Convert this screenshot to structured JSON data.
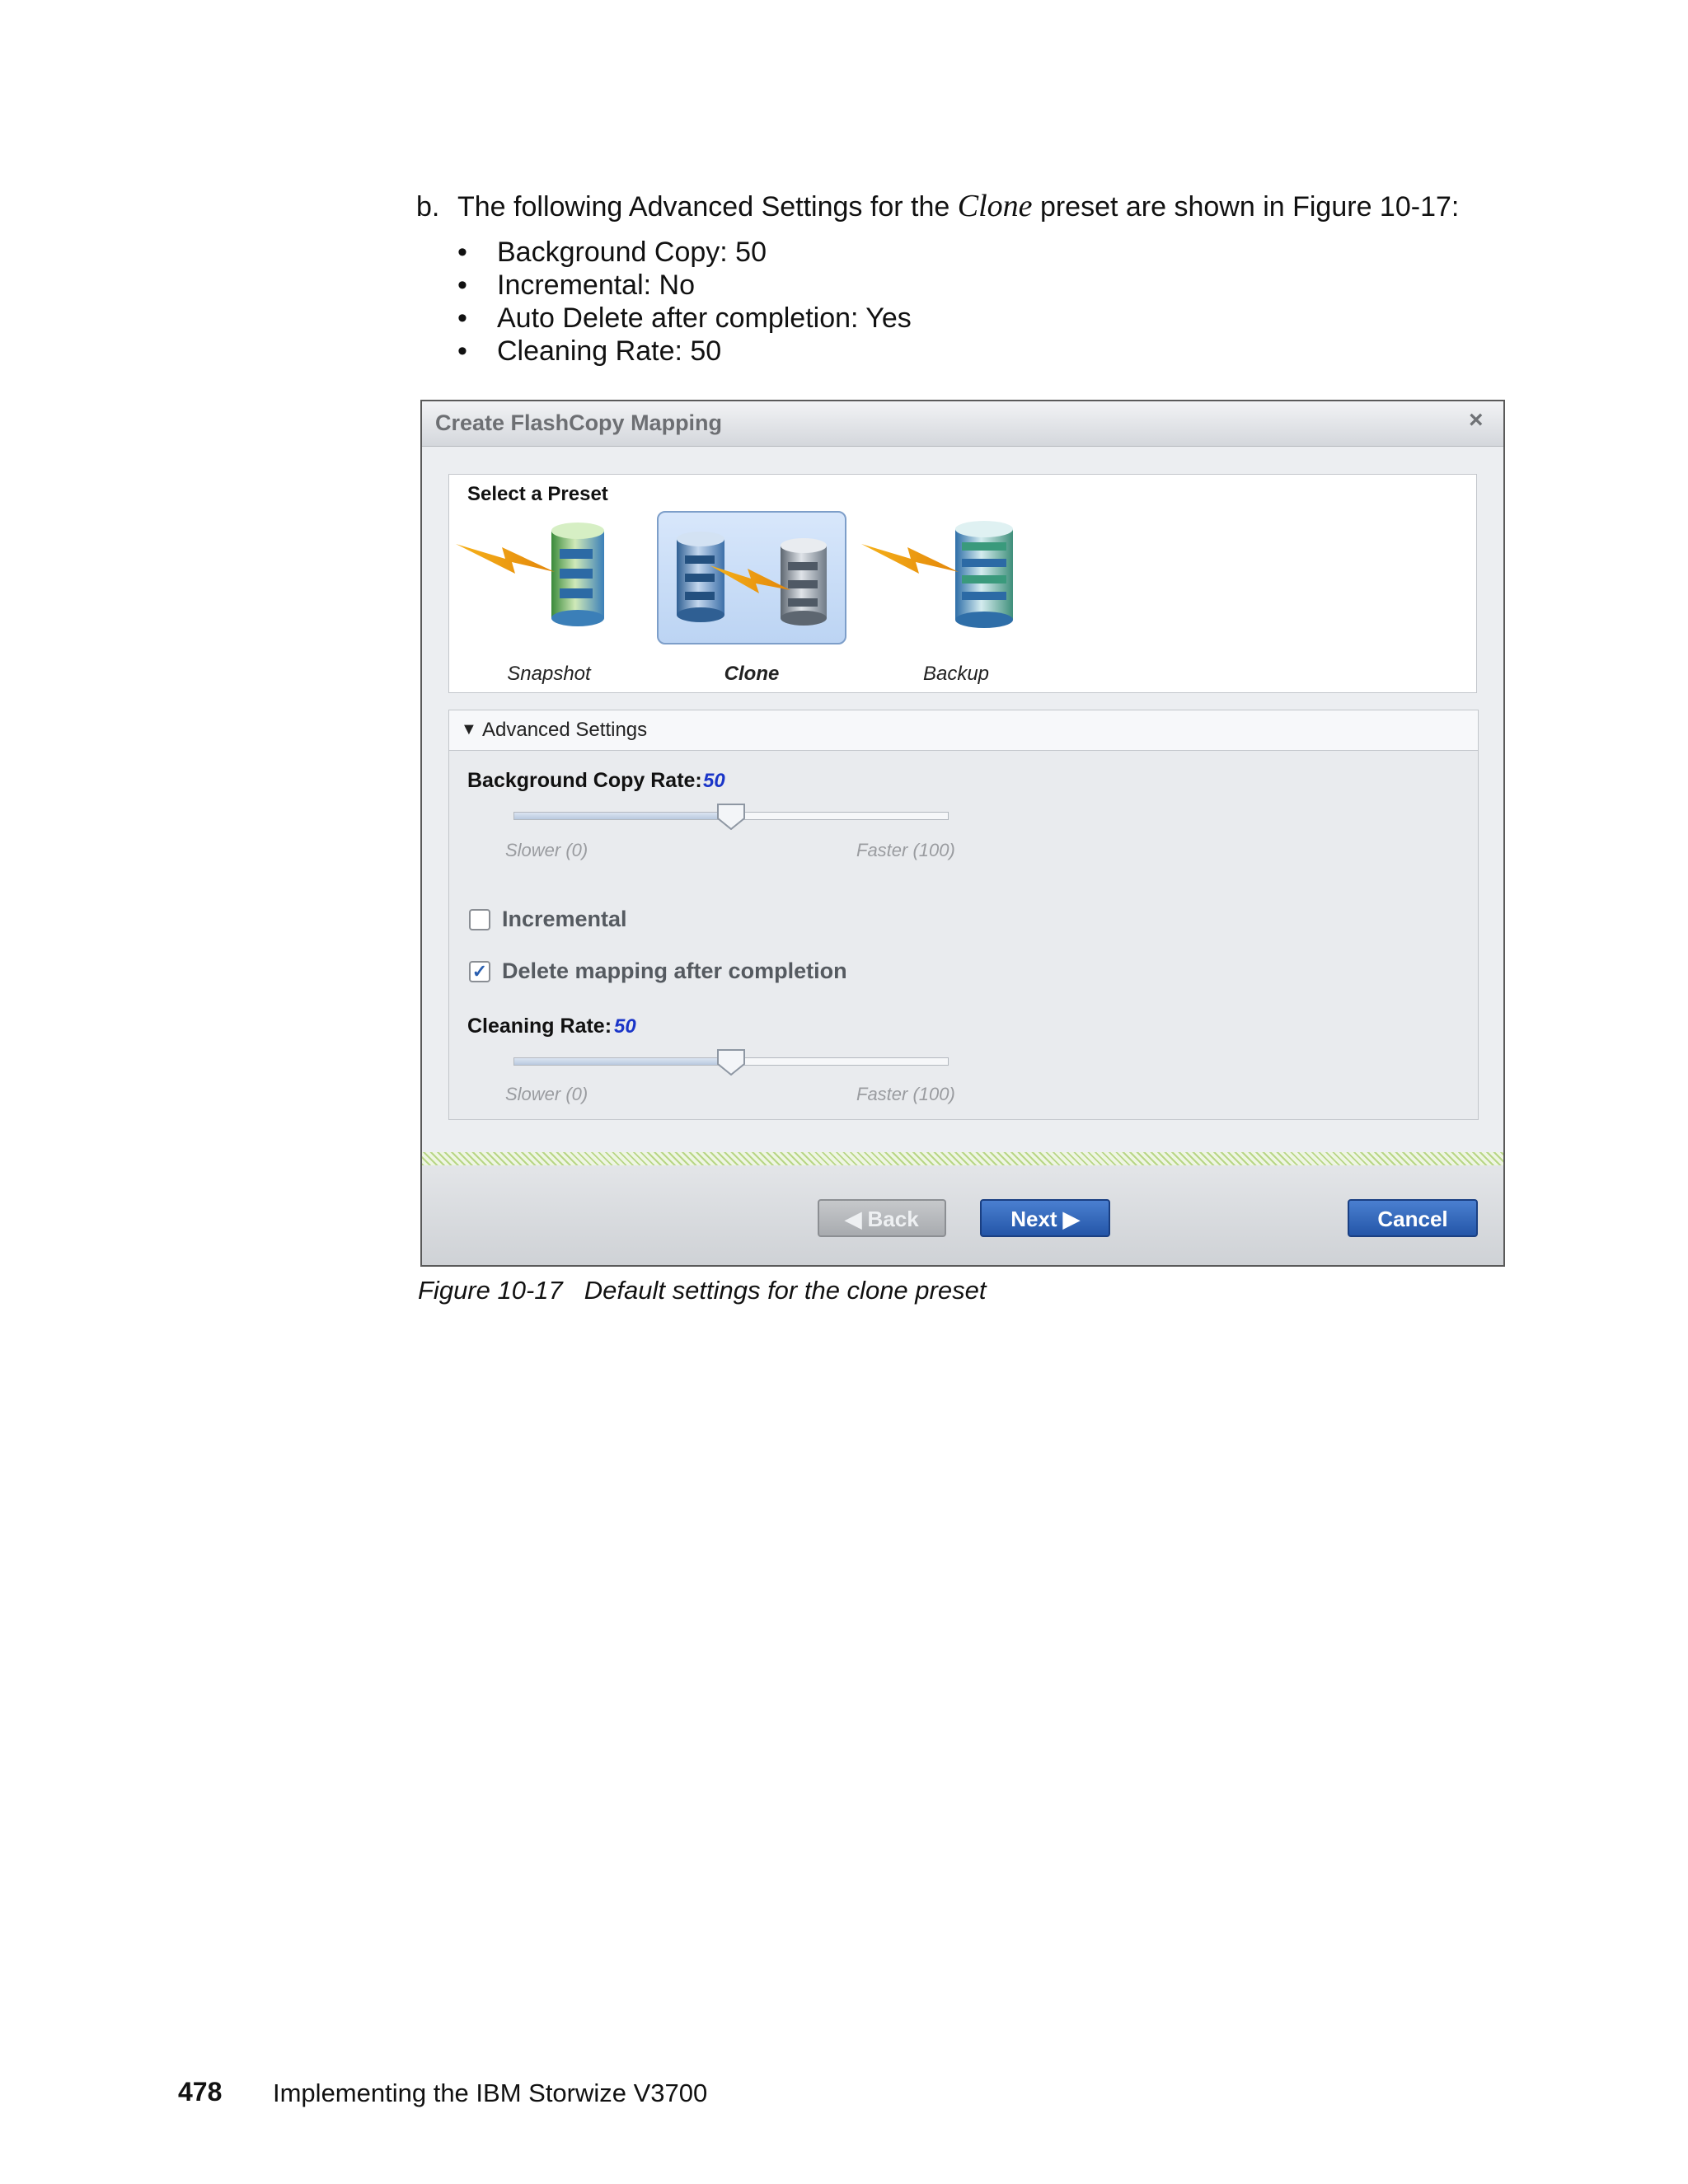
{
  "intro": {
    "marker": "b.",
    "text_before": "The following Advanced Settings for the ",
    "preset_name": "Clone",
    "text_after": " preset are shown in Figure 10-17:",
    "bullet_symbol": "•",
    "bullets": [
      "Background Copy: 50",
      "Incremental: No",
      "Auto Delete after completion: Yes",
      "Cleaning Rate: 50"
    ]
  },
  "dialog": {
    "title": "Create FlashCopy Mapping",
    "close_symbol": "×",
    "presets": {
      "title": "Select a Preset",
      "items": [
        {
          "label": "Snapshot",
          "icon": "snapshot-icon",
          "selected": false
        },
        {
          "label": "Clone",
          "icon": "clone-icon",
          "selected": true
        },
        {
          "label": "Backup",
          "icon": "backup-icon",
          "selected": false
        }
      ]
    },
    "advanced": {
      "toggle_symbol": "▼",
      "title": "Advanced Settings",
      "background_copy_rate": {
        "label": "Background Copy Rate:",
        "value": "50",
        "fraction": 0.5,
        "min_label": "Slower (0)",
        "max_label": "Faster (100)"
      },
      "incremental": {
        "label": "Incremental",
        "checked": false
      },
      "delete_after": {
        "label": "Delete mapping after completion",
        "checked": true,
        "check_symbol": "✓"
      },
      "cleaning_rate": {
        "label": "Cleaning Rate:",
        "value": "50",
        "fraction": 0.5,
        "min_label": "Slower (0)",
        "max_label": "Faster (100)"
      }
    },
    "buttons": {
      "back": "◀ Back",
      "next": "Next ▶",
      "cancel": "Cancel"
    }
  },
  "caption": {
    "figure_number": "Figure 10-17",
    "text": "Default settings for the clone preset"
  },
  "footer": {
    "page_number": "478",
    "book_title": "Implementing the IBM Storwize V3700"
  },
  "colors": {
    "value_blue": "#1a35c8",
    "button_blue": "#2456a8",
    "selected_preset": "#bcd4f3"
  }
}
